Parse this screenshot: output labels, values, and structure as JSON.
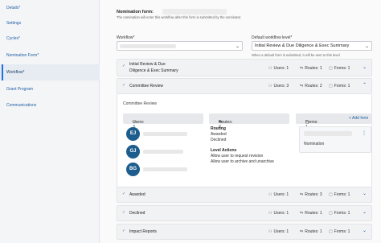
{
  "sidebar": {
    "items": [
      {
        "label": "Details*"
      },
      {
        "label": "Settings"
      },
      {
        "label": "Cycles*"
      },
      {
        "label": "Nomination Form*"
      },
      {
        "label": "Workflow*"
      },
      {
        "label": "Grant Program"
      },
      {
        "label": "Communications"
      }
    ]
  },
  "nomination_form": {
    "title": "Nomination form:",
    "description": "The nomination will enter this workflow after this form is submitted by the nominator."
  },
  "workflow": {
    "label": "Workflow*",
    "default_level_label": "Default workflow level*",
    "default_level_value": "Initial Review & Due Diligence & Exec Summary",
    "default_level_hint": "When a default form is submitted, it will be sent to this level"
  },
  "levels": [
    {
      "title_line1": "Initial Review & Due",
      "title_line2": "Diligence & Exec Summary",
      "users": "Users: 1",
      "routes": "Routes: 1",
      "forms": "Forms: 1",
      "chevron": "⌄"
    },
    {
      "title_line1": "Committee Review",
      "users": "Users: 3",
      "routes": "Routes: 2",
      "forms": "Forms: 1",
      "chevron": "⌃"
    },
    {
      "title_line1": "Awarded",
      "users": "Users: 1",
      "routes": "Routes: 3",
      "forms": "Forms: 1",
      "chevron": "⌄"
    },
    {
      "title_line1": "Declined",
      "users": "Users: 1",
      "routes": "Routes: 1",
      "forms": "Forms: 1",
      "chevron": "⌄"
    },
    {
      "title_line1": "Impact Reports",
      "users": "Users: 1",
      "routes": "Routes: 1",
      "forms": "Forms: 1",
      "chevron": "⌄"
    }
  ],
  "committee": {
    "label": "Committee Review",
    "users_header": "Users: 3",
    "routes_header": "Routes: 2",
    "forms_header": "Forms: 1",
    "avatars": [
      "EJ",
      "GJ",
      "BG"
    ],
    "routing_title": "Routing",
    "routing_items": [
      "Awarded",
      "Declined"
    ],
    "level_actions_title": "Level Actions",
    "level_actions_items": [
      "Allow user to request revision",
      "Allow user to archive and unarchive"
    ],
    "add_form": "+ Add form",
    "form_name": "Nomination"
  },
  "icons": {
    "check": "✓",
    "users": "⚇",
    "routes": "⇆",
    "forms": "▢",
    "dots": "⋮"
  },
  "colors": {
    "accent": "#1f6feb",
    "link": "#1f5fa3",
    "avatar": "#1d5d8e"
  }
}
